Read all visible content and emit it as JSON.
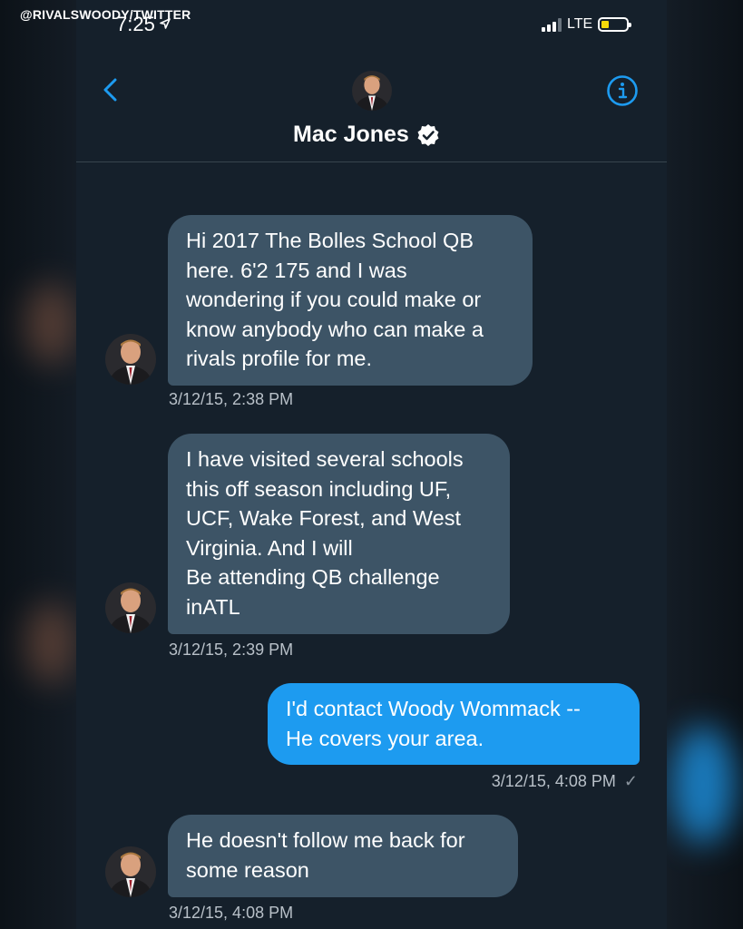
{
  "watermark": "@RIVALSWOODY/TWITTER",
  "status_bar": {
    "time": "7:25",
    "network": "LTE"
  },
  "header": {
    "title": "Mac Jones"
  },
  "icons": {
    "back": "chevron-left-icon",
    "info": "info-icon",
    "verified": "verified-badge-icon",
    "location": "location-arrow-icon"
  },
  "colors": {
    "background": "#15202b",
    "incoming_bubble": "#3d5466",
    "outgoing_bubble": "#1d9bf0",
    "accent": "#1d9bf0",
    "timestamp": "#b8c0c8"
  },
  "messages": [
    {
      "direction": "incoming",
      "lines": [
        "Hi 2017 The Bolles School QB",
        "here. 6'2 175 and I was",
        "wondering if you could make or",
        "know anybody who can make a",
        "rivals profile for me."
      ],
      "timestamp": "3/12/15, 2:38 PM"
    },
    {
      "direction": "incoming",
      "lines": [
        "I have visited several schools",
        "this off season including UF,",
        "UCF, Wake Forest, and West",
        "Virginia. And I will",
        "Be attending QB challenge",
        "inATL"
      ],
      "timestamp": "3/12/15, 2:39 PM"
    },
    {
      "direction": "outgoing",
      "lines": [
        "I'd contact Woody Wommack --",
        "He covers your area."
      ],
      "timestamp": "3/12/15, 4:08 PM",
      "read_mark": "✓"
    },
    {
      "direction": "incoming",
      "lines": [
        "He doesn't follow me back for",
        "some reason"
      ],
      "timestamp": "3/12/15, 4:08 PM"
    }
  ]
}
